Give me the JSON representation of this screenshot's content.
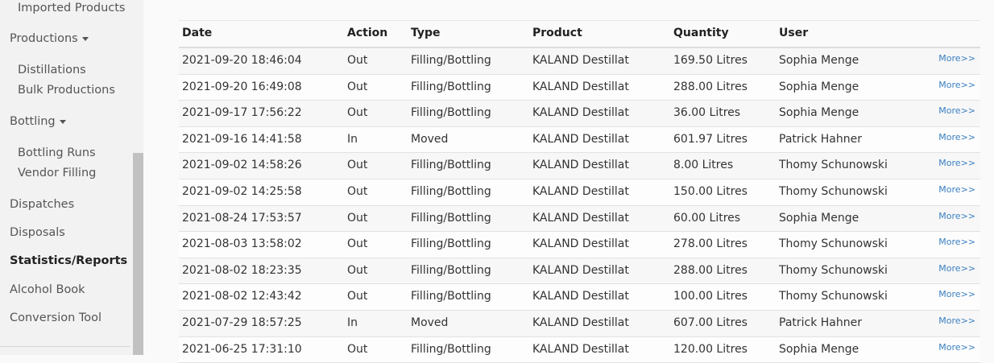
{
  "sidebar": {
    "items": [
      {
        "label": "Imported Products",
        "level": "sub"
      },
      {
        "label": "Productions",
        "level": "top",
        "dropdown": true
      },
      {
        "label": "Distillations",
        "level": "sub"
      },
      {
        "label": "Bulk Productions",
        "level": "sub"
      },
      {
        "label": "Bottling",
        "level": "top",
        "dropdown": true
      },
      {
        "label": "Bottling Runs",
        "level": "sub"
      },
      {
        "label": "Vendor Filling",
        "level": "sub"
      },
      {
        "label": "Dispatches",
        "level": "top"
      },
      {
        "label": "Disposals",
        "level": "top"
      },
      {
        "label": "Statistics/Reports",
        "level": "top",
        "active": true
      },
      {
        "label": "Alcohol Book",
        "level": "top"
      },
      {
        "label": "Conversion Tool",
        "level": "top"
      }
    ]
  },
  "table": {
    "headers": {
      "date": "Date",
      "action": "Action",
      "type": "Type",
      "product": "Product",
      "quantity": "Quantity",
      "user": "User"
    },
    "more_label": "More>>",
    "rows": [
      {
        "date": "2021-09-20 18:46:04",
        "action": "Out",
        "type": "Filling/Bottling",
        "product": "KALAND Destillat",
        "quantity": "169.50 Litres",
        "user": "Sophia Menge"
      },
      {
        "date": "2021-09-20 16:49:08",
        "action": "Out",
        "type": "Filling/Bottling",
        "product": "KALAND Destillat",
        "quantity": "288.00 Litres",
        "user": "Sophia Menge"
      },
      {
        "date": "2021-09-17 17:56:22",
        "action": "Out",
        "type": "Filling/Bottling",
        "product": "KALAND Destillat",
        "quantity": "36.00 Litres",
        "user": "Sophia Menge"
      },
      {
        "date": "2021-09-16 14:41:58",
        "action": "In",
        "type": "Moved",
        "product": "KALAND Destillat",
        "quantity": "601.97 Litres",
        "user": "Patrick Hahner"
      },
      {
        "date": "2021-09-02 14:58:26",
        "action": "Out",
        "type": "Filling/Bottling",
        "product": "KALAND Destillat",
        "quantity": "8.00 Litres",
        "user": "Thomy Schunowski"
      },
      {
        "date": "2021-09-02 14:25:58",
        "action": "Out",
        "type": "Filling/Bottling",
        "product": "KALAND Destillat",
        "quantity": "150.00 Litres",
        "user": "Thomy Schunowski"
      },
      {
        "date": "2021-08-24 17:53:57",
        "action": "Out",
        "type": "Filling/Bottling",
        "product": "KALAND Destillat",
        "quantity": "60.00 Litres",
        "user": "Sophia Menge"
      },
      {
        "date": "2021-08-03 13:58:02",
        "action": "Out",
        "type": "Filling/Bottling",
        "product": "KALAND Destillat",
        "quantity": "278.00 Litres",
        "user": "Thomy Schunowski"
      },
      {
        "date": "2021-08-02 18:23:35",
        "action": "Out",
        "type": "Filling/Bottling",
        "product": "KALAND Destillat",
        "quantity": "288.00 Litres",
        "user": "Thomy Schunowski"
      },
      {
        "date": "2021-08-02 12:43:42",
        "action": "Out",
        "type": "Filling/Bottling",
        "product": "KALAND Destillat",
        "quantity": "100.00 Litres",
        "user": "Thomy Schunowski"
      },
      {
        "date": "2021-07-29 18:57:25",
        "action": "In",
        "type": "Moved",
        "product": "KALAND Destillat",
        "quantity": "607.00 Litres",
        "user": "Patrick Hahner"
      },
      {
        "date": "2021-06-25 17:31:10",
        "action": "Out",
        "type": "Filling/Bottling",
        "product": "KALAND Destillat",
        "quantity": "120.00 Litres",
        "user": "Sophia Menge"
      }
    ]
  }
}
